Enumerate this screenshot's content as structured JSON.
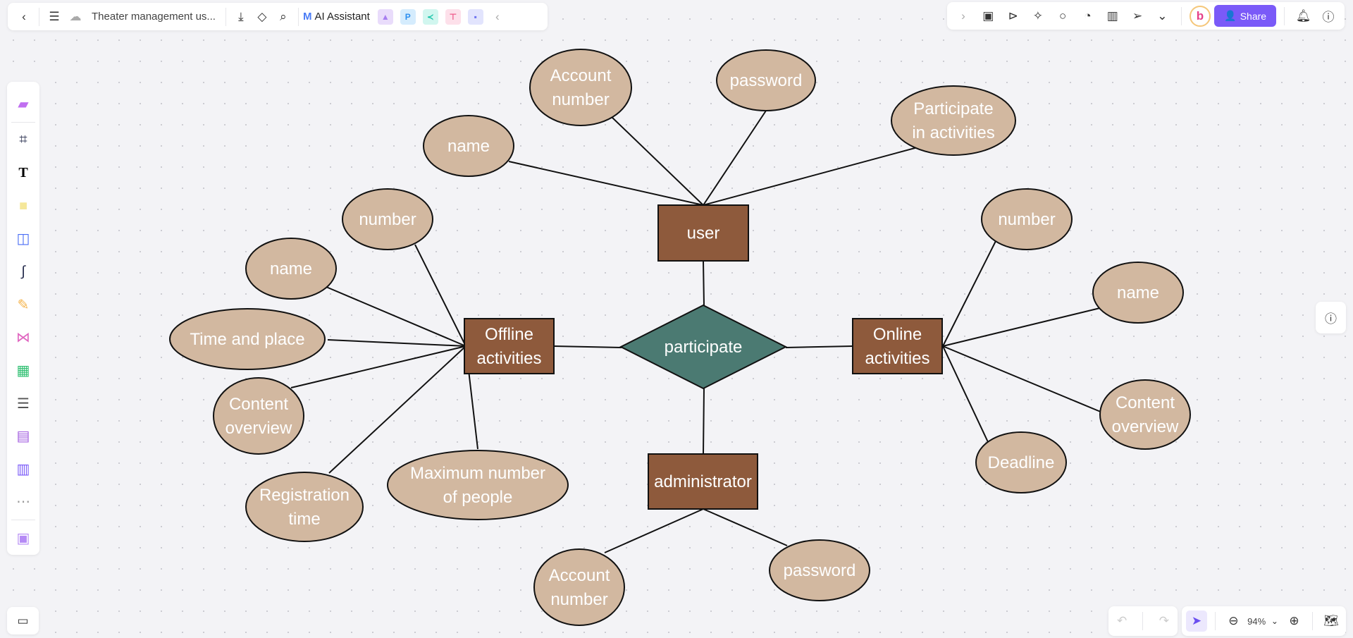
{
  "toolbar": {
    "document_title": "Theater management us...",
    "ai_assistant": "AI Assistant",
    "share": "Share",
    "zoom_level": "94%"
  },
  "icons": {
    "left": [
      "back-icon",
      "menu-icon",
      "cloud-sync-icon",
      "download-icon",
      "tag-icon",
      "search-icon"
    ],
    "apps": [
      "image-gen-app",
      "p-app",
      "mindmap-app",
      "flow-app",
      "chat-app"
    ],
    "right": [
      "lock-file-icon",
      "present-icon",
      "celebrate-icon",
      "comment-icon",
      "timer-icon",
      "vote-icon",
      "laser-icon",
      "more-icon"
    ]
  },
  "colors": {
    "entity": "#8e5a3c",
    "relation": "#4b7a72",
    "attribute": "#d2b8a0",
    "accent": "#7a5af8"
  },
  "diagram": {
    "entities": [
      {
        "id": "user",
        "label": [
          "user"
        ]
      },
      {
        "id": "offline",
        "label": [
          "Offline",
          "activities"
        ]
      },
      {
        "id": "online",
        "label": [
          "Online",
          "activities"
        ]
      },
      {
        "id": "admin",
        "label": [
          "administrator"
        ]
      }
    ],
    "relation": {
      "label": [
        "participate"
      ]
    },
    "attributes": [
      {
        "entity": "user",
        "label": [
          "Account",
          "number"
        ]
      },
      {
        "entity": "user",
        "label": [
          "password"
        ]
      },
      {
        "entity": "user",
        "label": [
          "Participate",
          "in activities"
        ]
      },
      {
        "entity": "user",
        "label": [
          "name"
        ]
      },
      {
        "entity": "offline",
        "label": [
          "number"
        ]
      },
      {
        "entity": "offline",
        "label": [
          "name"
        ]
      },
      {
        "entity": "offline",
        "label": [
          "Time and place"
        ]
      },
      {
        "entity": "offline",
        "label": [
          "Content",
          "overview"
        ]
      },
      {
        "entity": "offline",
        "label": [
          "Registration",
          "time"
        ]
      },
      {
        "entity": "offline",
        "label": [
          "Maximum number",
          "of people"
        ]
      },
      {
        "entity": "online",
        "label": [
          "number"
        ]
      },
      {
        "entity": "online",
        "label": [
          "name"
        ]
      },
      {
        "entity": "online",
        "label": [
          "Content",
          "overview"
        ]
      },
      {
        "entity": "online",
        "label": [
          "Deadline"
        ]
      },
      {
        "entity": "admin",
        "label": [
          "Account",
          "number"
        ]
      },
      {
        "entity": "admin",
        "label": [
          "password"
        ]
      }
    ]
  }
}
